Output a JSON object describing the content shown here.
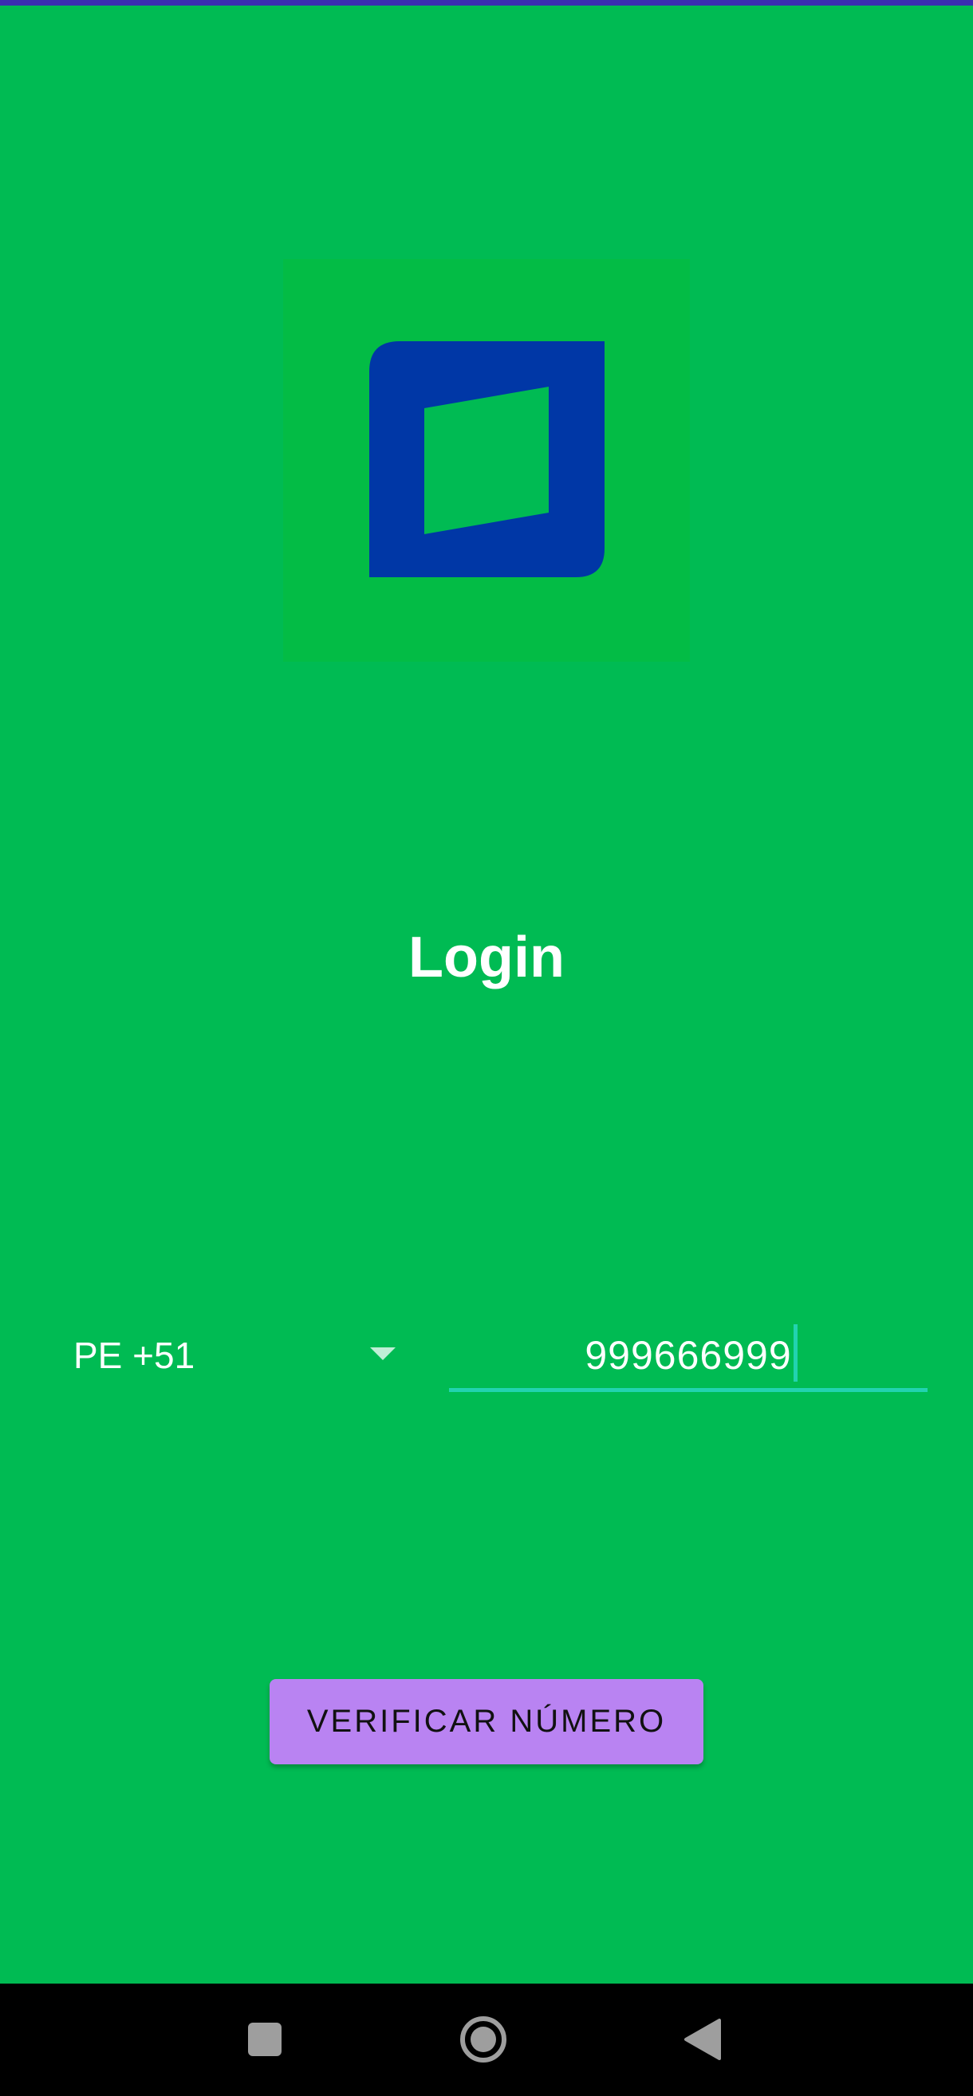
{
  "colors": {
    "background": "#00BB53",
    "logo_blue": "#0037A6",
    "accent": "#22D3B0",
    "button": "#B983F2"
  },
  "header": {
    "title": "Login"
  },
  "form": {
    "country_code": "PE +51",
    "phone_number": "999666999"
  },
  "actions": {
    "verify_label": "VERIFICAR NÚMERO"
  },
  "nav": {
    "icons": [
      "square-recents-icon",
      "circle-home-icon",
      "triangle-back-icon"
    ]
  }
}
